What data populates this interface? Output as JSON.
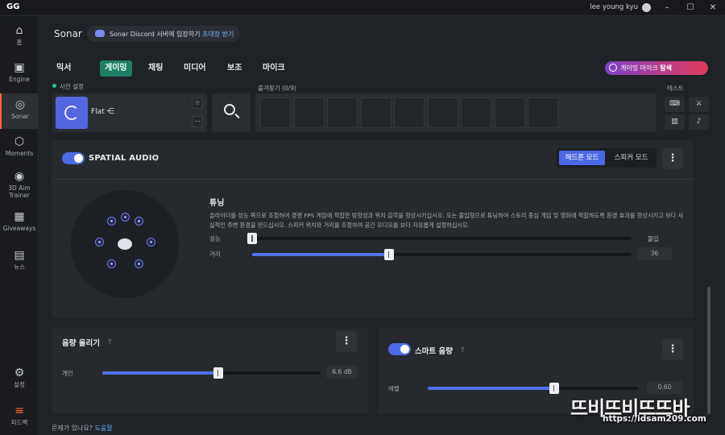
{
  "titlebar": {
    "app": "GG",
    "user": "lee young kyu",
    "minimize": "–",
    "maximize": "☐",
    "close": "✕"
  },
  "sidebar": {
    "items": [
      {
        "icon": "home-icon",
        "glyph": "⌂",
        "label": "홈"
      },
      {
        "icon": "chip-icon",
        "glyph": "▣",
        "label": "Engine"
      },
      {
        "icon": "sonar-icon",
        "glyph": "◎",
        "label": "Sonar"
      },
      {
        "icon": "moments-icon",
        "glyph": "⬡",
        "label": "Moments"
      },
      {
        "icon": "aim-icon",
        "glyph": "◉",
        "label": "3D Aim Trainer"
      },
      {
        "icon": "gift-icon",
        "glyph": "▦",
        "label": "Giveaways"
      },
      {
        "icon": "book-icon",
        "glyph": "▤",
        "label": "뉴스"
      }
    ],
    "settings": {
      "icon": "gear-icon",
      "glyph": "⚙",
      "label": "설정"
    },
    "feedback": {
      "icon": "feedback-icon",
      "glyph": "≡",
      "label": "피드백"
    }
  },
  "header": {
    "title": "Sonar",
    "discord_text": "Sonar Discord 서버에 입장하기",
    "discord_link": "초대장 받기"
  },
  "tabs": [
    "믹서",
    "게이밍",
    "채팅",
    "미디어",
    "보조",
    "마이크"
  ],
  "active_tab": "게이밍",
  "mic_search": {
    "label": "게이밍 마이크",
    "action": "탐색"
  },
  "presets": {
    "label": "사전 설정",
    "current": "Flat",
    "favorites_label": "즐겨찾기 (0/9)",
    "favorite_slots": 9,
    "test_label": "테스트"
  },
  "spatial": {
    "title": "SPATIAL AUDIO",
    "help": "?",
    "mode_headphone": "헤드폰 모드",
    "mode_speaker": "스피커 모드",
    "tuning_title": "튜닝",
    "tuning_desc": "슬라이더를 성능 쪽으로 조정하여 경쟁 FPS 게임에 적합한 방향성과 위치 감각을 향상시키십시오. 또는 몰입형으로 튜닝하여 스토리 중심 게임 및 영화에 적합하도록 환경 효과를 향상시키고 보다 사실적인 주변 환경을 만드십시오. 스피커 위치와 거리를 조정하여 공간 오디오를 보다 자유롭게 설정하십시오.",
    "performance_label": "성능",
    "immersion_label": "몰입",
    "performance_value": 0.0,
    "distance_label": "거리",
    "distance_value": "36",
    "distance_fraction": 0.36
  },
  "volume_boost": {
    "title": "음량 올리기",
    "help": "?",
    "gain_label": "게인",
    "gain_value": "6.6 dB",
    "gain_fraction": 0.53
  },
  "smart_volume": {
    "title": "스마트 음량",
    "help": "?",
    "level_label": "레벨",
    "level_value": "0.60",
    "level_fraction": 0.6
  },
  "footer": {
    "text": "문제가 있나요?",
    "link": "도움말"
  },
  "watermark": {
    "main": "뜨비뜨비뜨뜨바",
    "url": "https://idsam209.com"
  },
  "colors": {
    "accent": "#4e6be8",
    "active_tab": "#1e7d65",
    "sidebar_active": "#ff6a2f"
  }
}
